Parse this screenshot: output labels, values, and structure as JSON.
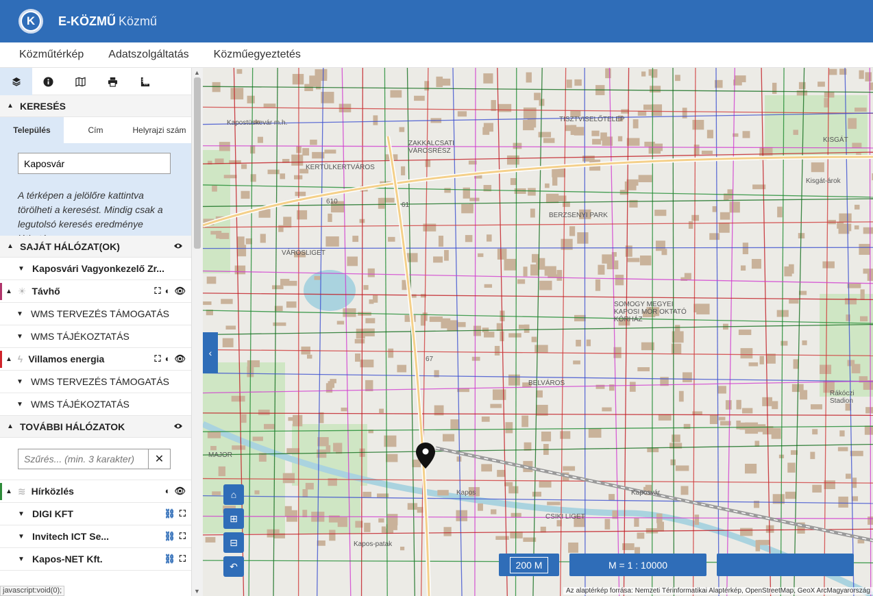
{
  "app": {
    "logo_letter": "K",
    "title_bold": "E-KÖZMŰ",
    "title_sub": "Közmű"
  },
  "menu": [
    "Közműtérkép",
    "Adatszolgáltatás",
    "Közműegyeztetés"
  ],
  "toolbar": {
    "icons": [
      "layers-icon",
      "info-icon",
      "map-icon",
      "print-icon",
      "measure-icon"
    ]
  },
  "search": {
    "header": "KERESÉS",
    "tabs": [
      "Település",
      "Cím",
      "Helyrajzi szám"
    ],
    "input_value": "Kaposvár",
    "hint": "A térképen a jelölőre kattintva törölheti a keresést. Mindig csak a legutolsó keresés eredménye látható."
  },
  "own_networks": {
    "header": "SAJÁT HÁLÓZAT(OK)",
    "org": "Kaposvári Vagyonkezelő Zr...",
    "layers": [
      {
        "name": "Távhő",
        "color": "#b0356b",
        "items": [
          "WMS TERVEZÉS TÁMOGATÁS",
          "WMS TÁJÉKOZTATÁS"
        ]
      },
      {
        "name": "Villamos energia",
        "color": "#d0242b",
        "items": [
          "WMS TERVEZÉS TÁMOGATÁS",
          "WMS TÁJÉKOZTATÁS"
        ]
      }
    ]
  },
  "other_networks": {
    "header": "TOVÁBBI HÁLÓZATOK",
    "filter_placeholder": "Szűrés... (min. 3 karakter)",
    "layer": {
      "name": "Hírközlés",
      "color": "#2e8b3a"
    },
    "providers": [
      "DIGI KFT",
      "Invitech ICT Se...",
      "Kapos-NET Kft."
    ]
  },
  "status_text": "javascript:void(0);",
  "map": {
    "labels": [
      "Kapostüskevár m.h.",
      "TISZTVISELŐTELEP",
      "KISGÁT",
      "ZAKKALCSATI VÁROSRÉSZ",
      "KERTÜLKERTVÁROS",
      "BERZSENYI PARK",
      "VÁROSLIGET",
      "SOMOGY MEGYEI KAPOSI MÓR OKTATÓ KÓRHÁZ",
      "BELVÁROS",
      "Rákóczi Stadion",
      "MAJOR",
      "Kapos",
      "Kaposvár",
      "CSIKI LIGET",
      "Kapos-patak",
      "Kisgát-árok",
      "610",
      "61",
      "67"
    ],
    "scale_bar": "200 M",
    "scale_ratio": "M = 1 : 10000",
    "attribution": "Az alaptérkép forrása: Nemzeti Térinformatikai Alaptérkép, OpenStreetMap, GeoX ArcMagyarország"
  }
}
